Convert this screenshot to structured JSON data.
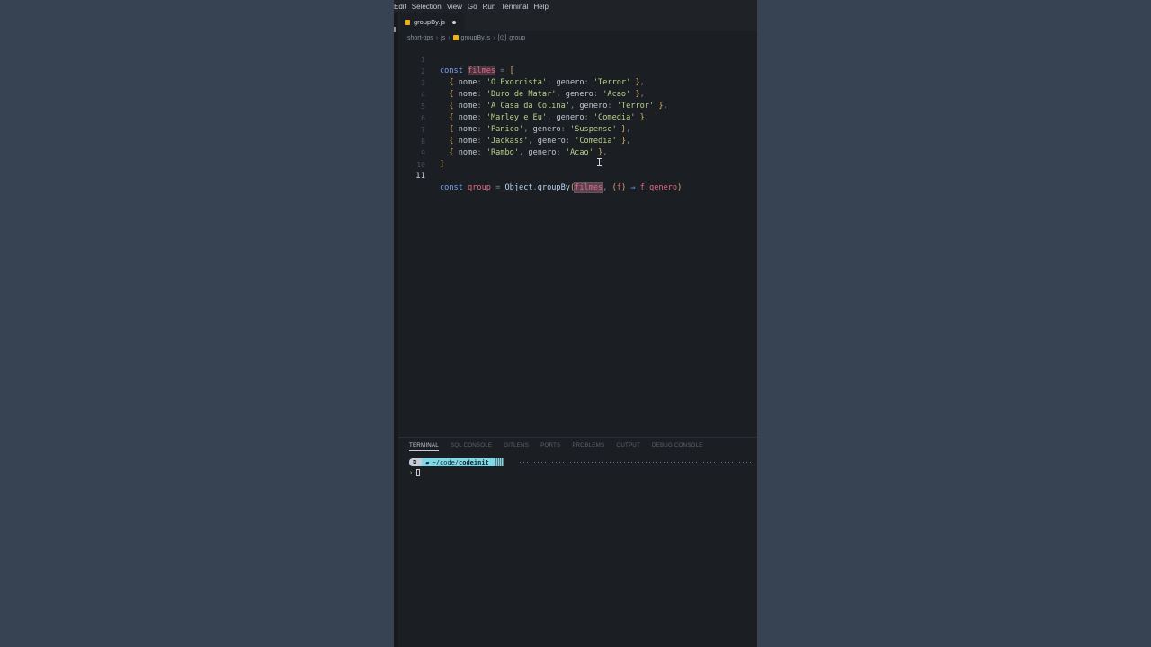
{
  "menu": [
    "Edit",
    "Selection",
    "View",
    "Go",
    "Run",
    "Terminal",
    "Help"
  ],
  "tab": {
    "filename": "groupBy.js"
  },
  "breadcrumbs": [
    "short-tips",
    "js",
    "groupBy.js",
    "group"
  ],
  "line_numbers": [
    "1",
    "2",
    "3",
    "4",
    "5",
    "6",
    "7",
    "8",
    "9",
    "10",
    "11"
  ],
  "code": {
    "kw_const": "const",
    "var_filmes": "filmes",
    "var_group": "group",
    "prop_nome": "nome",
    "prop_genero": "genero",
    "object": "Object",
    "method": "groupBy",
    "param": "f",
    "rows": [
      {
        "nome": "'O Exorcista'",
        "genero": "'Terror'"
      },
      {
        "nome": "'Duro de Matar'",
        "genero": "'Acao'"
      },
      {
        "nome": "'A Casa da Colina'",
        "genero": "'Terror'"
      },
      {
        "nome": "'Marley e Eu'",
        "genero": "'Comedia'"
      },
      {
        "nome": "'Panico'",
        "genero": "'Suspense'"
      },
      {
        "nome": "'Jackass'",
        "genero": "'Comedia'"
      },
      {
        "nome": "'Rambo'",
        "genero": "'Acao'"
      }
    ]
  },
  "panel_tabs": [
    "TERMINAL",
    "SQL CONSOLE",
    "GITLENS",
    "PORTS",
    "PROBLEMS",
    "OUTPUT",
    "DEBUG CONSOLE"
  ],
  "terminal": {
    "path_prefix": "~/code/",
    "path_dir": "codeinit",
    "prompt_char": "›"
  }
}
